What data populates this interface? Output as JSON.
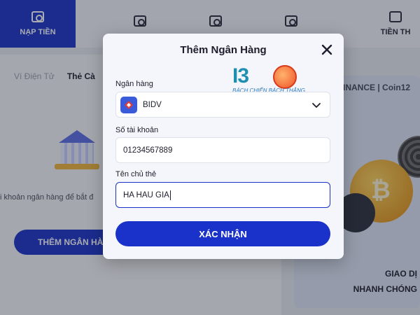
{
  "background": {
    "nav": {
      "tabs": [
        {
          "label": "NẠP TIỀN",
          "active": true
        },
        {
          "label": ""
        },
        {
          "label": ""
        },
        {
          "label": ""
        }
      ],
      "right_label": "TIỀN TH"
    },
    "subtabs": [
      "Ví Điện Tử",
      "Thẻ Cà"
    ],
    "bank_description": "i khoản ngân hàng để bắt đ",
    "add_bank_button": "THÊM NGÂN HÀ",
    "partners": "INANCE  |  Coin12",
    "promo_lines": [
      "GIAO DỊ",
      "NHANH CHÓNG"
    ]
  },
  "modal": {
    "title": "Thêm Ngân Hàng",
    "brand": {
      "name": "I38",
      "tagline": "BÁCH CHIẾN BÁCH THẮNG"
    },
    "fields": {
      "bank": {
        "label": "Ngân hàng",
        "value": "BIDV",
        "icon": "bidv-logo-icon"
      },
      "account_number": {
        "label": "Số tài khoản",
        "value": "01234567889"
      },
      "holder_name": {
        "label": "Tên chủ thẻ",
        "value": "HA HAU GIA"
      }
    },
    "confirm_button": "XÁC NHẬN"
  },
  "colors": {
    "accent": "#1a32c9",
    "overlay": "rgba(30,34,48,0.38)",
    "modal_bg": "#f5f6fb"
  }
}
